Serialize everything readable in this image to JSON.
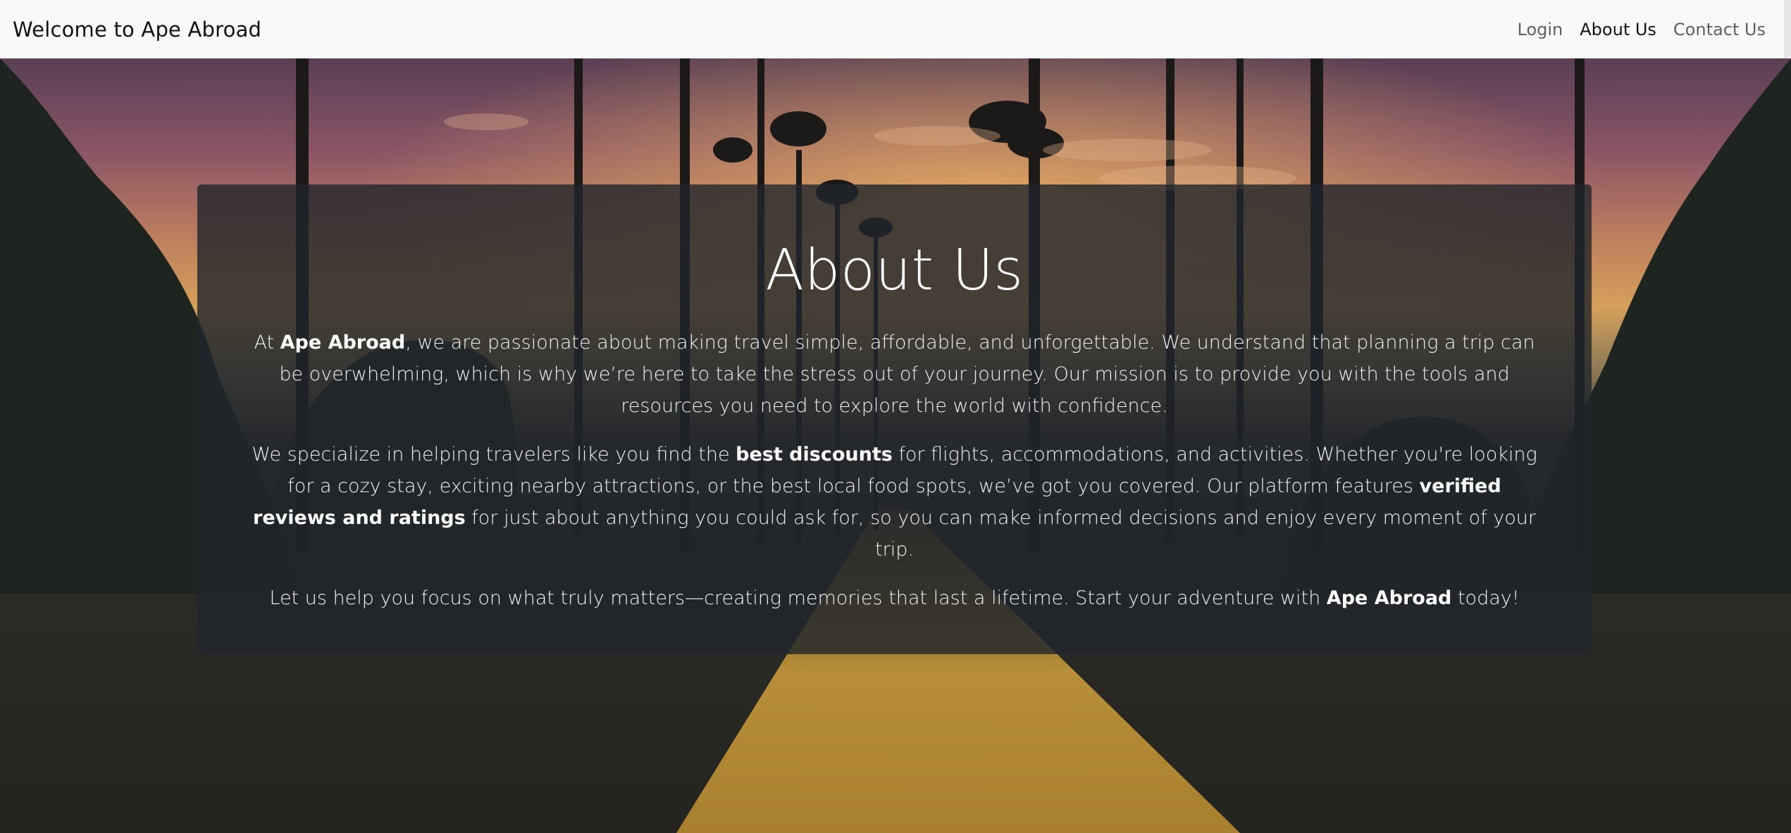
{
  "navbar": {
    "brand": "Welcome to Ape Abroad",
    "links": [
      {
        "label": "Login",
        "active": false
      },
      {
        "label": "About Us",
        "active": true
      },
      {
        "label": "Contact Us",
        "active": false
      }
    ]
  },
  "about": {
    "title": "About Us",
    "p1": {
      "a": "At ",
      "b": "Ape Abroad",
      "c": ", we are passionate about making travel simple, affordable, and unforgettable. We understand that planning a trip can be overwhelming, which is why we’re here to take the stress out of your journey. Our mission is to provide you with the tools and resources you need to explore the world with confidence."
    },
    "p2": {
      "a": "We specialize in helping travelers like you find the ",
      "b": "best discounts",
      "c": " for flights, accommodations, and activities. Whether you're looking for a cozy stay, exciting nearby attractions, or the best local food spots, we’ve got you covered. Our platform features ",
      "d": "verified reviews and ratings",
      "e": " for just about anything you could ask for, so you can make informed decisions and enjoy every moment of your trip."
    },
    "p3": {
      "a": "Let us help you focus on what truly matters—creating memories that last a lifetime. Start your adventure with ",
      "b": "Ape Abroad",
      "c": " today!"
    }
  },
  "colors": {
    "navbar_bg": "#f8f9fa",
    "panel_bg": "rgba(33,37,44,0.80)",
    "text_light": "#ffffff"
  },
  "icons": {
    "background": "palm-tree-road-sunset-image"
  }
}
